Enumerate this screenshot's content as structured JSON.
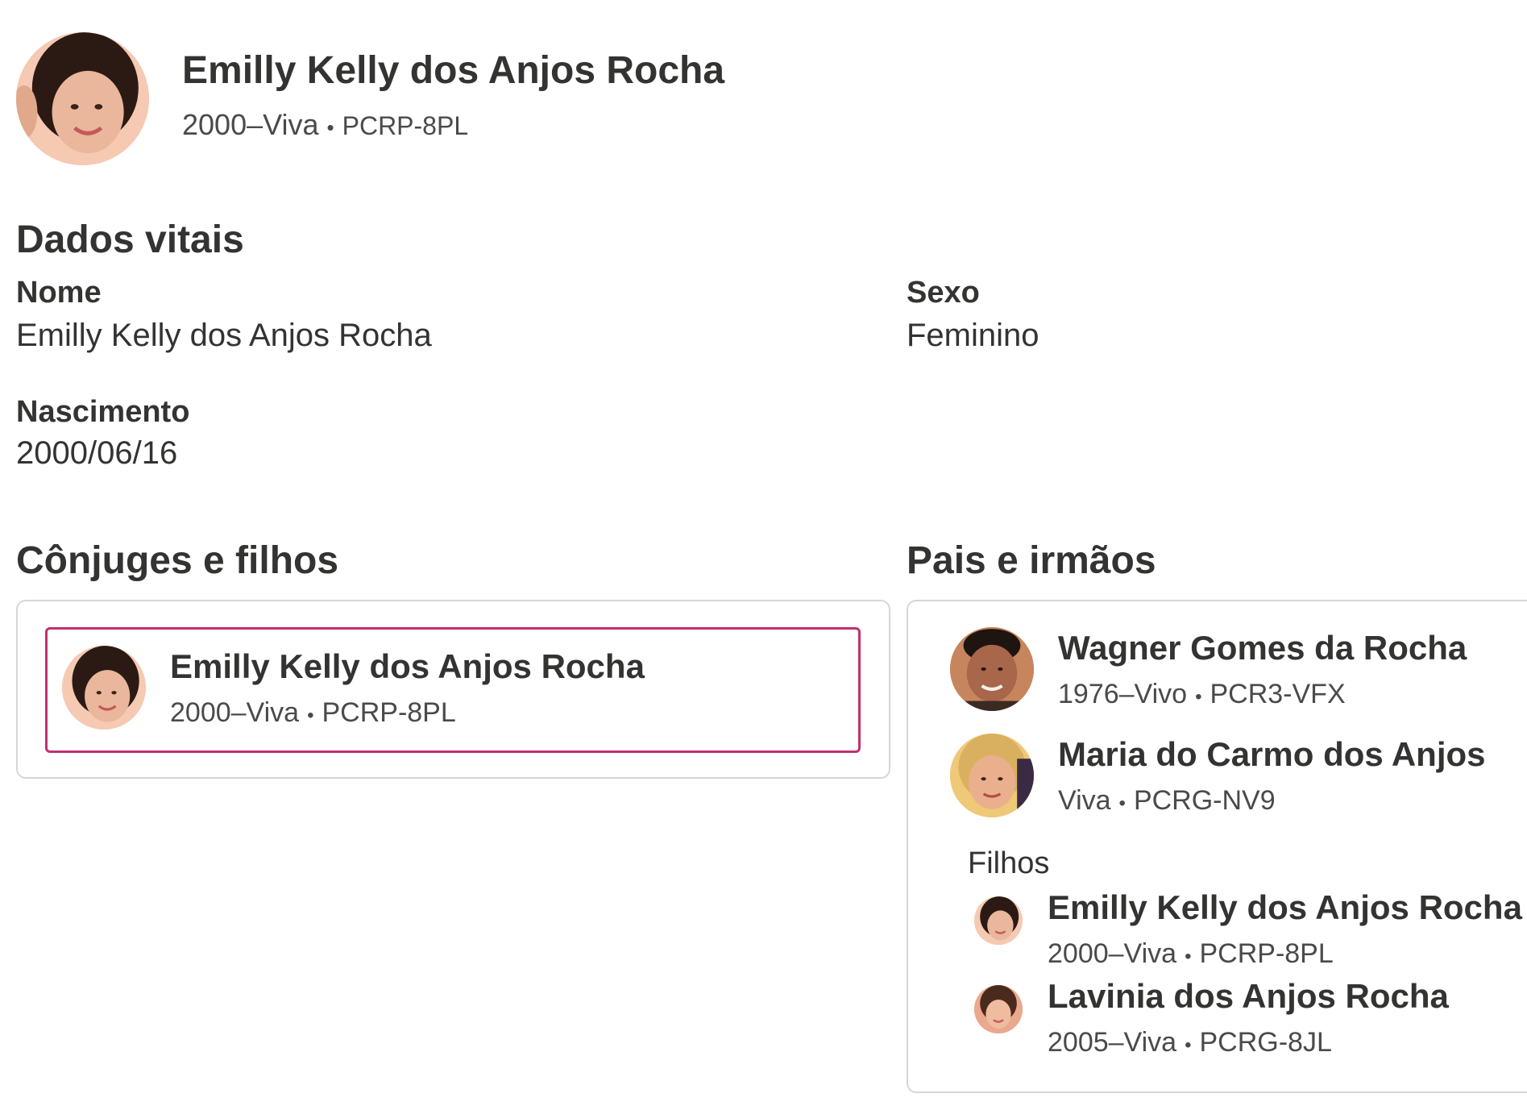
{
  "person": {
    "name": "Emilly Kelly dos Anjos Rocha",
    "lifespan": "2000–Viva",
    "separator": "•",
    "id": "PCRP-8PL"
  },
  "vitals": {
    "title": "Dados vitais",
    "name_label": "Nome",
    "name_value": "Emilly Kelly dos Anjos Rocha",
    "sex_label": "Sexo",
    "sex_value": "Feminino",
    "birth_label": "Nascimento",
    "birth_value": "2000/06/16"
  },
  "spouses": {
    "title": "Cônjuges e filhos",
    "entry": {
      "name": "Emilly Kelly dos Anjos Rocha",
      "lifespan": "2000–Viva",
      "id": "PCRP-8PL"
    }
  },
  "parents": {
    "title": "Pais e irmãos",
    "father": {
      "name": "Wagner Gomes da Rocha",
      "lifespan": "1976–Vivo",
      "id": "PCR3-VFX"
    },
    "mother": {
      "name": "Maria do Carmo dos Anjos",
      "lifespan": "Viva",
      "id": "PCRG-NV9"
    },
    "children_label": "Filhos",
    "children": [
      {
        "name": "Emilly Kelly dos Anjos Rocha",
        "lifespan": "2000–Viva",
        "id": "PCRP-8PL"
      },
      {
        "name": "Lavinia dos Anjos Rocha",
        "lifespan": "2005–Viva",
        "id": "PCRG-8JL"
      }
    ]
  },
  "colors": {
    "text": "#333331",
    "card_border": "#d6d6d4",
    "highlight_border": "#c0306f"
  }
}
